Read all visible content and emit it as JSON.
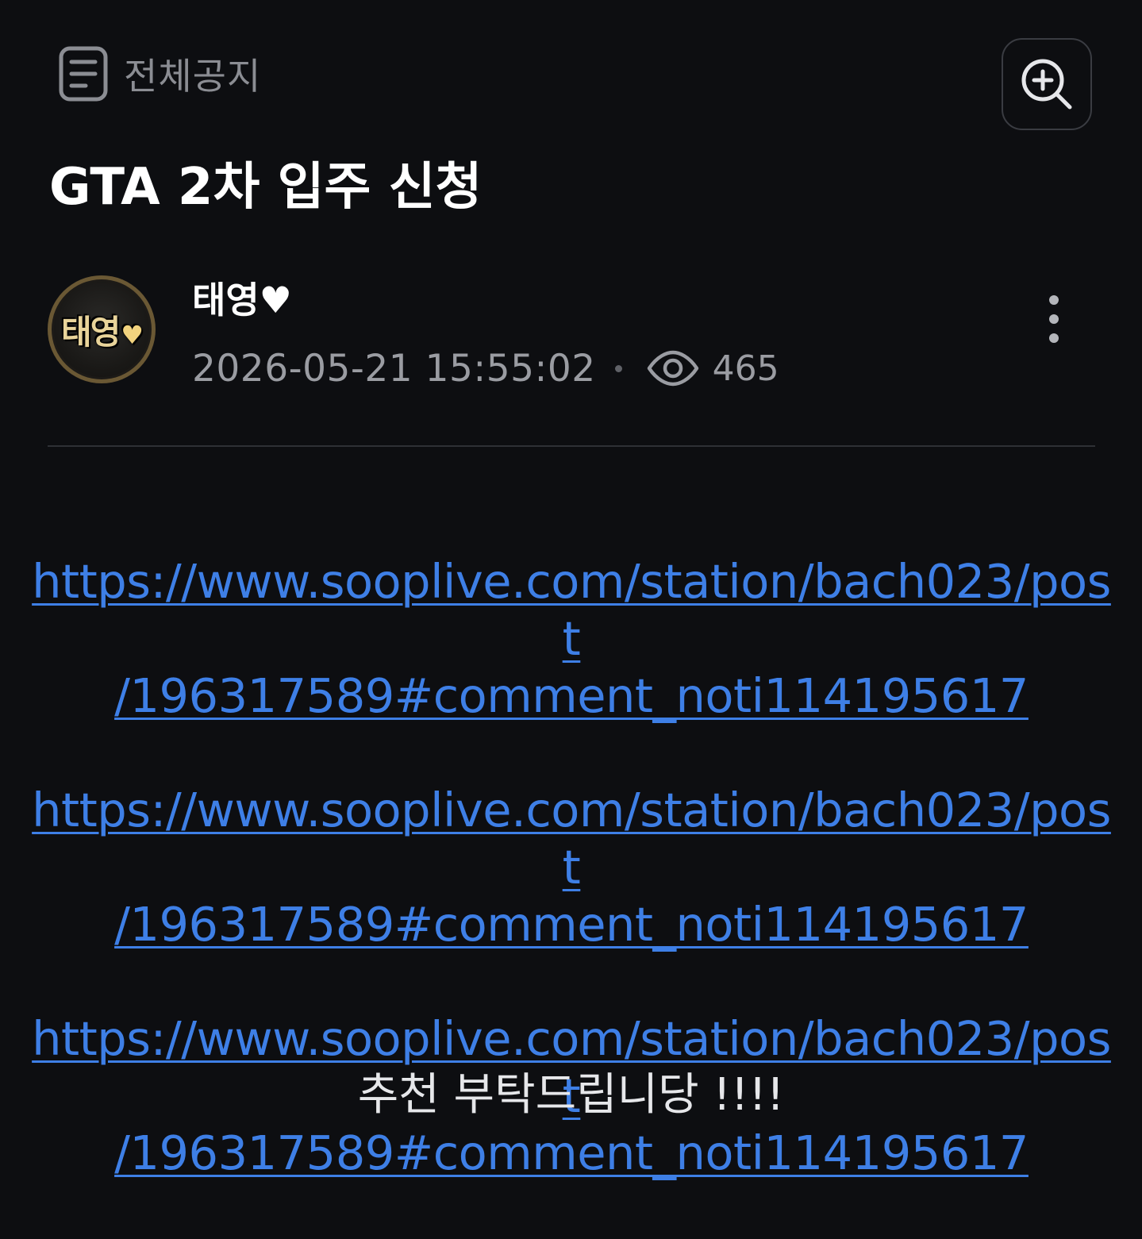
{
  "category": {
    "icon": "notice-list-icon",
    "label": "전체공지"
  },
  "toolbar": {
    "zoom_icon": "zoom-in-icon"
  },
  "post": {
    "title": "GTA 2차 입주 신청",
    "author": {
      "name": "태영♥",
      "avatar_text": "태영",
      "avatar_heart": "♥"
    },
    "date": "2026-05-21 15:55:02",
    "views": "465",
    "links": [
      {
        "line1": "https://www.sooplive.com/station/bach023/post",
        "line2": "/196317589#comment_noti114195617"
      },
      {
        "line1": "https://www.sooplive.com/station/bach023/post",
        "line2": "/196317589#comment_noti114195617"
      },
      {
        "line1": "https://www.sooplive.com/station/bach023/post",
        "line2": "/196317589#comment_noti114195617"
      }
    ],
    "closing": "추천 부탁드립니당 !!!!"
  },
  "colors": {
    "background": "#0d0e11",
    "link": "#3e7fe6",
    "muted_text": "#9a9ca2"
  }
}
